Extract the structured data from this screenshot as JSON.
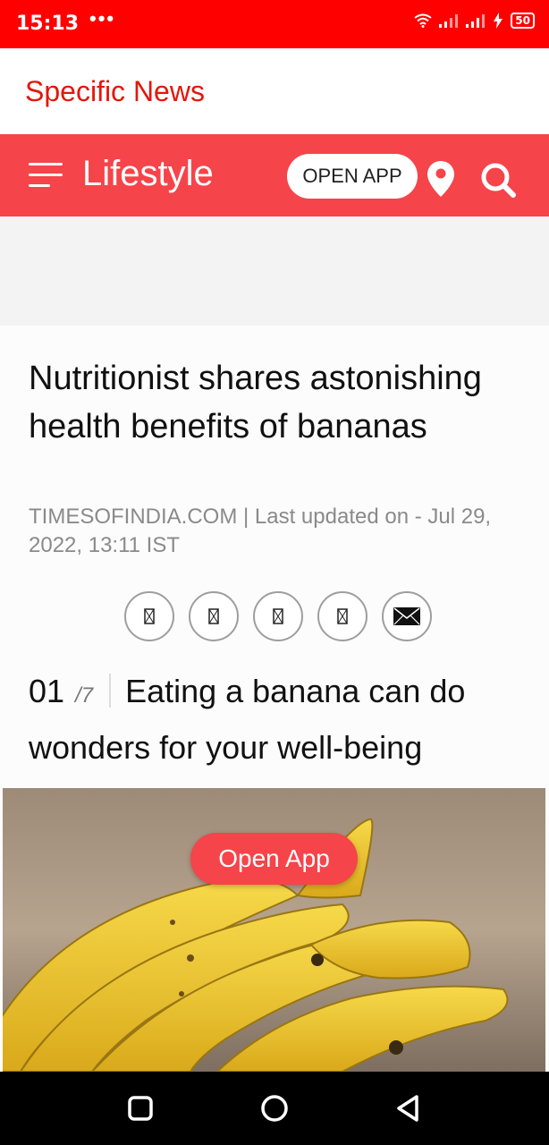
{
  "status_bar": {
    "time": "15:13",
    "dots": "•••",
    "battery": "50"
  },
  "header": {
    "site_title": "Specific News"
  },
  "section_bar": {
    "title": "Lifestyle",
    "open_app_label": "OPEN APP"
  },
  "article": {
    "headline": "Nutritionist shares astonishing health benefits of bananas",
    "byline": "TIMESOFINDIA.COM | Last updated on - Jul 29, 2022, 13:11 IST"
  },
  "slide": {
    "number": "01",
    "total": "/7",
    "caption": "Eating a banana can do wonders for your well-being"
  },
  "floating_button": {
    "label": "Open App"
  },
  "colors": {
    "status_bar": "#ff0000",
    "brand_red": "#f5444a",
    "site_title": "#e3170a"
  }
}
